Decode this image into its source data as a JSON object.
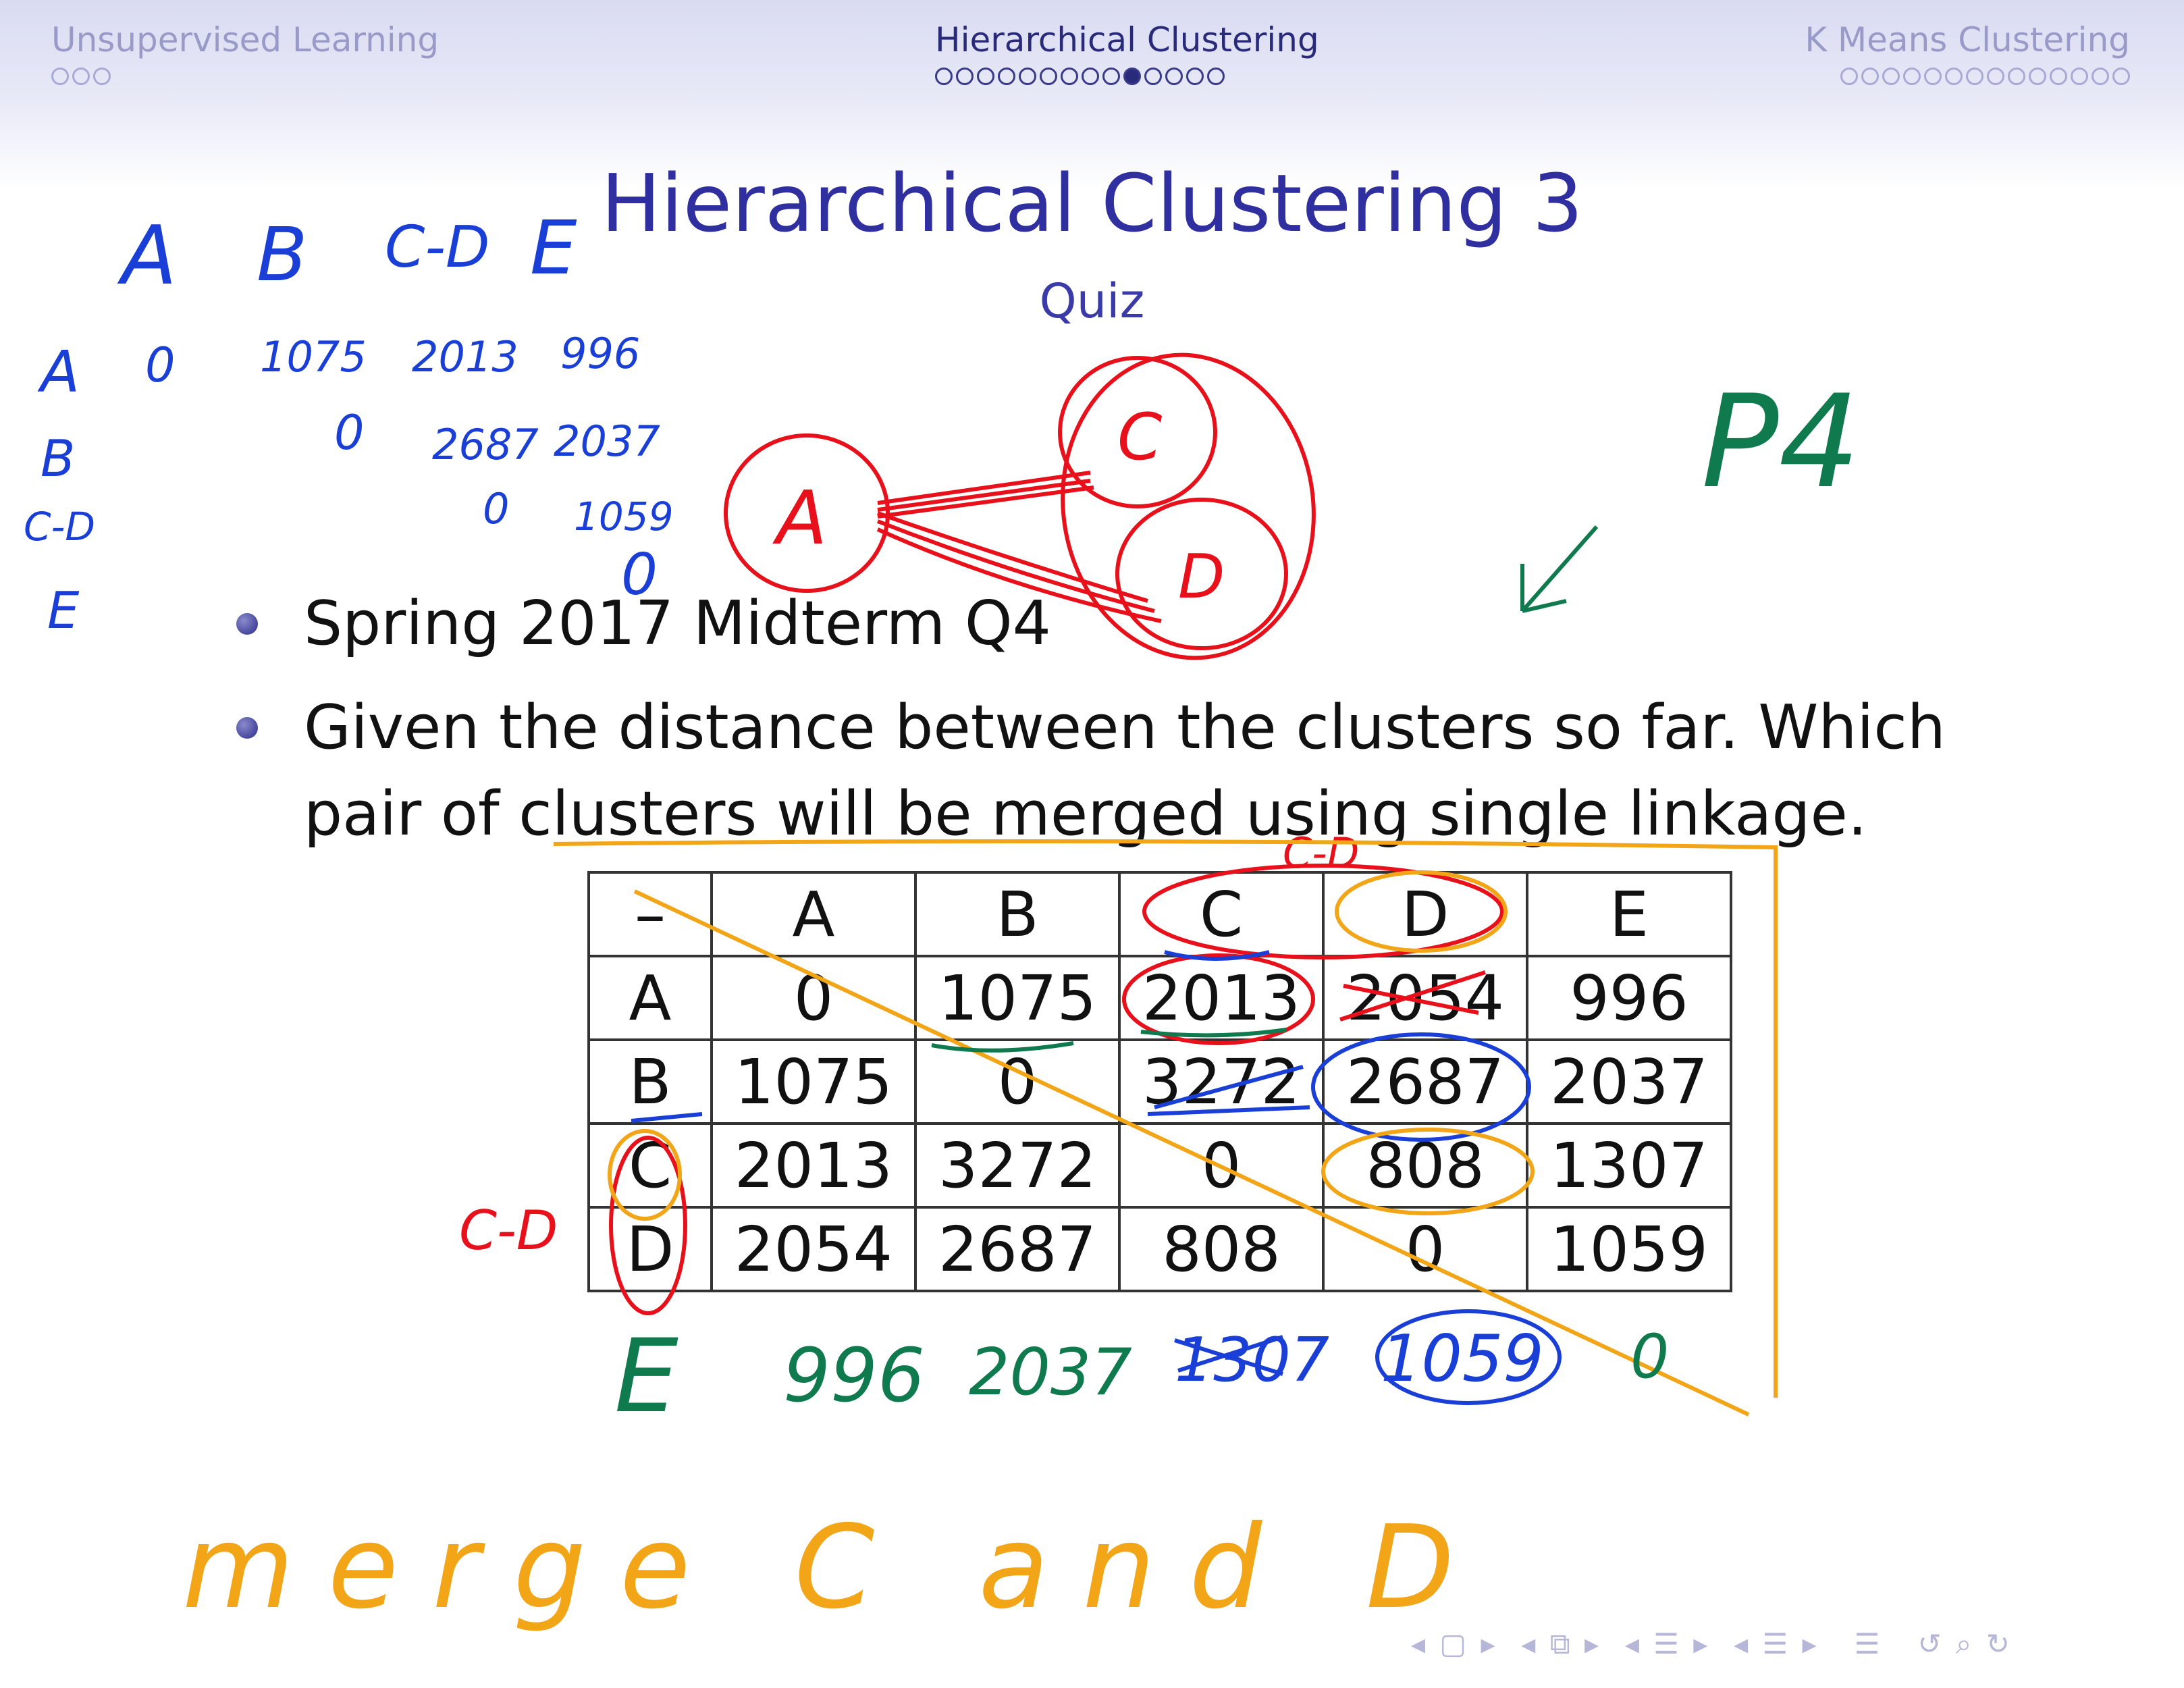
{
  "header": {
    "sections": [
      {
        "title": "Unsupervised Learning",
        "dot_count": 3,
        "active_dot": -1
      },
      {
        "title": "Hierarchical Clustering",
        "dot_count": 14,
        "active_dot": 9
      },
      {
        "title": "K Means Clustering",
        "dot_count": 14,
        "active_dot": -1
      }
    ]
  },
  "slide": {
    "title": "Hierarchical Clustering 3",
    "subtitle": "Quiz",
    "bullets": [
      "Spring 2017 Midterm Q4",
      "Given the distance between the clusters so far. Which pair of clusters will be merged using single linkage."
    ]
  },
  "table": {
    "corner": "–",
    "columns": [
      "A",
      "B",
      "C",
      "D",
      "E"
    ],
    "rows": [
      {
        "label": "A",
        "values": [
          "0",
          "1075",
          "2013",
          "2054",
          "996"
        ]
      },
      {
        "label": "B",
        "values": [
          "1075",
          "0",
          "3272",
          "2687",
          "2037"
        ]
      },
      {
        "label": "C",
        "values": [
          "2013",
          "3272",
          "0",
          "808",
          "1307"
        ]
      },
      {
        "label": "D",
        "values": [
          "2054",
          "2687",
          "808",
          "0",
          "1059"
        ]
      }
    ]
  },
  "annotations": {
    "blue_matrix_header": [
      "A",
      "B",
      "C-D",
      "E"
    ],
    "blue_matrix_rowlabels": [
      "A",
      "B",
      "C-D",
      "E"
    ],
    "blue_row_a": [
      "0",
      "1075",
      "2013",
      "996"
    ],
    "blue_row_b": [
      "0",
      "2687",
      "2037"
    ],
    "blue_row_cd": [
      "0",
      "1059"
    ],
    "blue_row_e": [
      "0"
    ],
    "red_cluster_nodes": [
      "A",
      "C",
      "D"
    ],
    "red_merged_label_top": "C-D",
    "red_merged_label_side": "C-D",
    "green_p4": "P4",
    "green_e_row_label": "E",
    "green_e_row_values": [
      "996",
      "2037",
      "1307",
      "1059",
      "0"
    ],
    "orange_conclusion": "merge C and D"
  },
  "ink_colors": {
    "blue": "#1a3fd6",
    "red": "#e8101a",
    "green": "#0e7a4e",
    "orange": "#f2a516"
  },
  "footer": {
    "nav_icons": [
      "prev-frame-icon",
      "prev-subsection-icon",
      "prev-section-icon",
      "next-section-icon",
      "appendix-icon",
      "search-icon"
    ]
  }
}
